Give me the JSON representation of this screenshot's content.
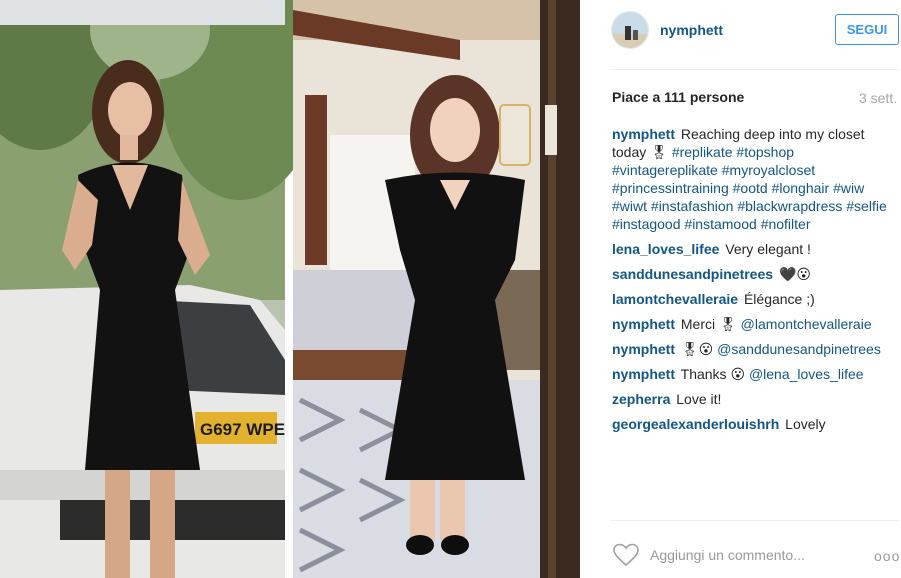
{
  "post": {
    "username": "nymphett",
    "follow_label": "SEGUI",
    "likes_text": "Piace a 111 persone",
    "time_ago": "3 sett.",
    "add_comment_placeholder": "Aggiungi un commento...",
    "more_label": "ooo"
  },
  "plate_text": "G697 WPE",
  "caption": {
    "user": "nymphett",
    "text_parts": [
      {
        "t": "Reaching deep into my closet today 🎖 ",
        "kind": "text"
      },
      {
        "t": "#replikate",
        "kind": "tag"
      },
      {
        "t": " ",
        "kind": "text"
      },
      {
        "t": "#topshop",
        "kind": "tag"
      },
      {
        "t": " ",
        "kind": "text"
      },
      {
        "t": "#vintagereplikate",
        "kind": "tag"
      },
      {
        "t": " ",
        "kind": "text"
      },
      {
        "t": "#myroyalcloset",
        "kind": "tag"
      },
      {
        "t": " ",
        "kind": "text"
      },
      {
        "t": "#princessintraining",
        "kind": "tag"
      },
      {
        "t": " ",
        "kind": "text"
      },
      {
        "t": "#ootd",
        "kind": "tag"
      },
      {
        "t": " ",
        "kind": "text"
      },
      {
        "t": "#longhair",
        "kind": "tag"
      },
      {
        "t": " ",
        "kind": "text"
      },
      {
        "t": "#wiw",
        "kind": "tag"
      },
      {
        "t": " ",
        "kind": "text"
      },
      {
        "t": "#wiwt",
        "kind": "tag"
      },
      {
        "t": " ",
        "kind": "text"
      },
      {
        "t": "#instafashion",
        "kind": "tag"
      },
      {
        "t": " ",
        "kind": "text"
      },
      {
        "t": "#blackwrapdress",
        "kind": "tag"
      },
      {
        "t": " ",
        "kind": "text"
      },
      {
        "t": "#selfie",
        "kind": "tag"
      },
      {
        "t": " ",
        "kind": "text"
      },
      {
        "t": "#instagood",
        "kind": "tag"
      },
      {
        "t": " ",
        "kind": "text"
      },
      {
        "t": "#instamood",
        "kind": "tag"
      },
      {
        "t": " ",
        "kind": "text"
      },
      {
        "t": "#nofilter",
        "kind": "tag"
      }
    ]
  },
  "comments": [
    {
      "user": "lena_loves_lifee",
      "parts": [
        {
          "t": "Very elegant !",
          "kind": "text"
        }
      ]
    },
    {
      "user": "sanddunesandpinetrees",
      "parts": [
        {
          "t": "🖤😮",
          "kind": "text"
        }
      ]
    },
    {
      "user": "lamontchevalleraie",
      "parts": [
        {
          "t": "Élégance ;)",
          "kind": "text"
        }
      ]
    },
    {
      "user": "nymphett",
      "parts": [
        {
          "t": "Merci 🎖 ",
          "kind": "text"
        },
        {
          "t": "@lamontchevalleraie",
          "kind": "mention"
        }
      ]
    },
    {
      "user": "nymphett",
      "parts": [
        {
          "t": "🎖😮 ",
          "kind": "text"
        },
        {
          "t": "@sanddunesandpinetrees",
          "kind": "mention"
        }
      ]
    },
    {
      "user": "nymphett",
      "parts": [
        {
          "t": "Thanks 😮 ",
          "kind": "text"
        },
        {
          "t": "@lena_loves_lifee",
          "kind": "mention"
        }
      ]
    },
    {
      "user": "zepherra",
      "parts": [
        {
          "t": "Love it!",
          "kind": "text"
        }
      ]
    },
    {
      "user": "georgealexanderlouishrh",
      "parts": [
        {
          "t": "Lovely",
          "kind": "text"
        }
      ]
    }
  ],
  "colors": {
    "link": "#125688",
    "follow_blue": "#3897f0",
    "muted": "#a5a7aa"
  },
  "icons": {
    "like": "heart-icon",
    "avatar": "avatar"
  }
}
